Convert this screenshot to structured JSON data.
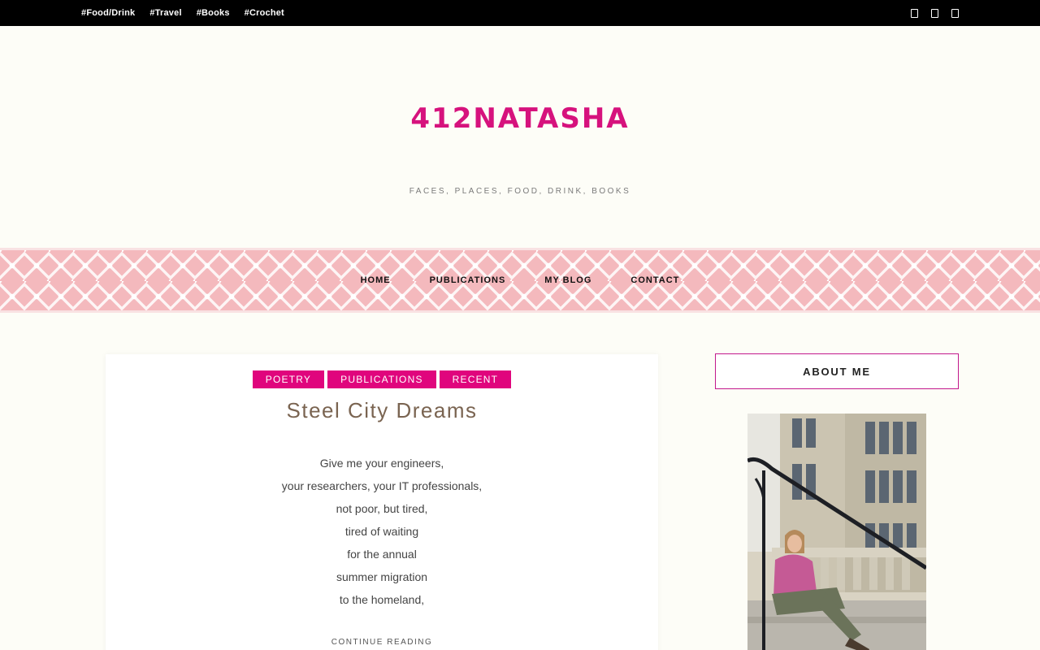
{
  "topbar": {
    "tags": [
      "#Food/Drink",
      "#Travel",
      "#Books",
      "#Crochet"
    ],
    "social_icons": [
      "social-icon-1",
      "social-icon-2",
      "social-icon-3"
    ]
  },
  "header": {
    "title": "412NATASHA",
    "tagline": "FACES, PLACES, FOOD, DRINK, BOOKS"
  },
  "nav": {
    "items": [
      "HOME",
      "PUBLICATIONS",
      "MY BLOG",
      "CONTACT"
    ]
  },
  "post": {
    "categories": [
      "POETRY",
      "PUBLICATIONS",
      "RECENT"
    ],
    "title": "Steel City Dreams",
    "lines": [
      "Give me your engineers,",
      "your researchers, your IT professionals,",
      "not poor, but tired,",
      "tired of waiting",
      "for the annual",
      "summer migration",
      "to the homeland,"
    ],
    "continue_label": "CONTINUE READING"
  },
  "sidebar": {
    "about_title": "ABOUT ME"
  },
  "colors": {
    "accent": "#e0057d",
    "title": "#d6127d",
    "band": "#f4b9bd"
  }
}
